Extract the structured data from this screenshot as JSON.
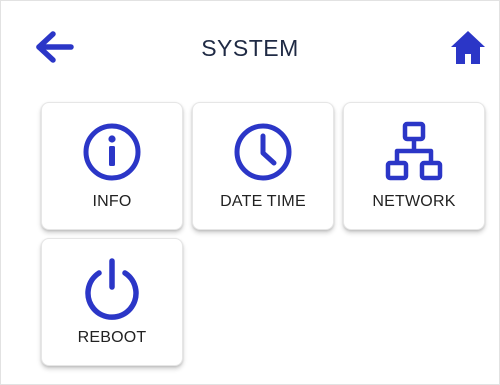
{
  "header": {
    "title": "SYSTEM",
    "back_icon": "arrow-left-icon",
    "home_icon": "home-icon"
  },
  "tiles": [
    {
      "label": "INFO",
      "icon": "info-icon"
    },
    {
      "label": "DATE TIME",
      "icon": "clock-icon"
    },
    {
      "label": "NETWORK",
      "icon": "network-icon"
    },
    {
      "label": "REBOOT",
      "icon": "power-icon"
    }
  ],
  "colors": {
    "accent": "#2b36c7",
    "title": "#1f2a44",
    "label": "#222222"
  }
}
